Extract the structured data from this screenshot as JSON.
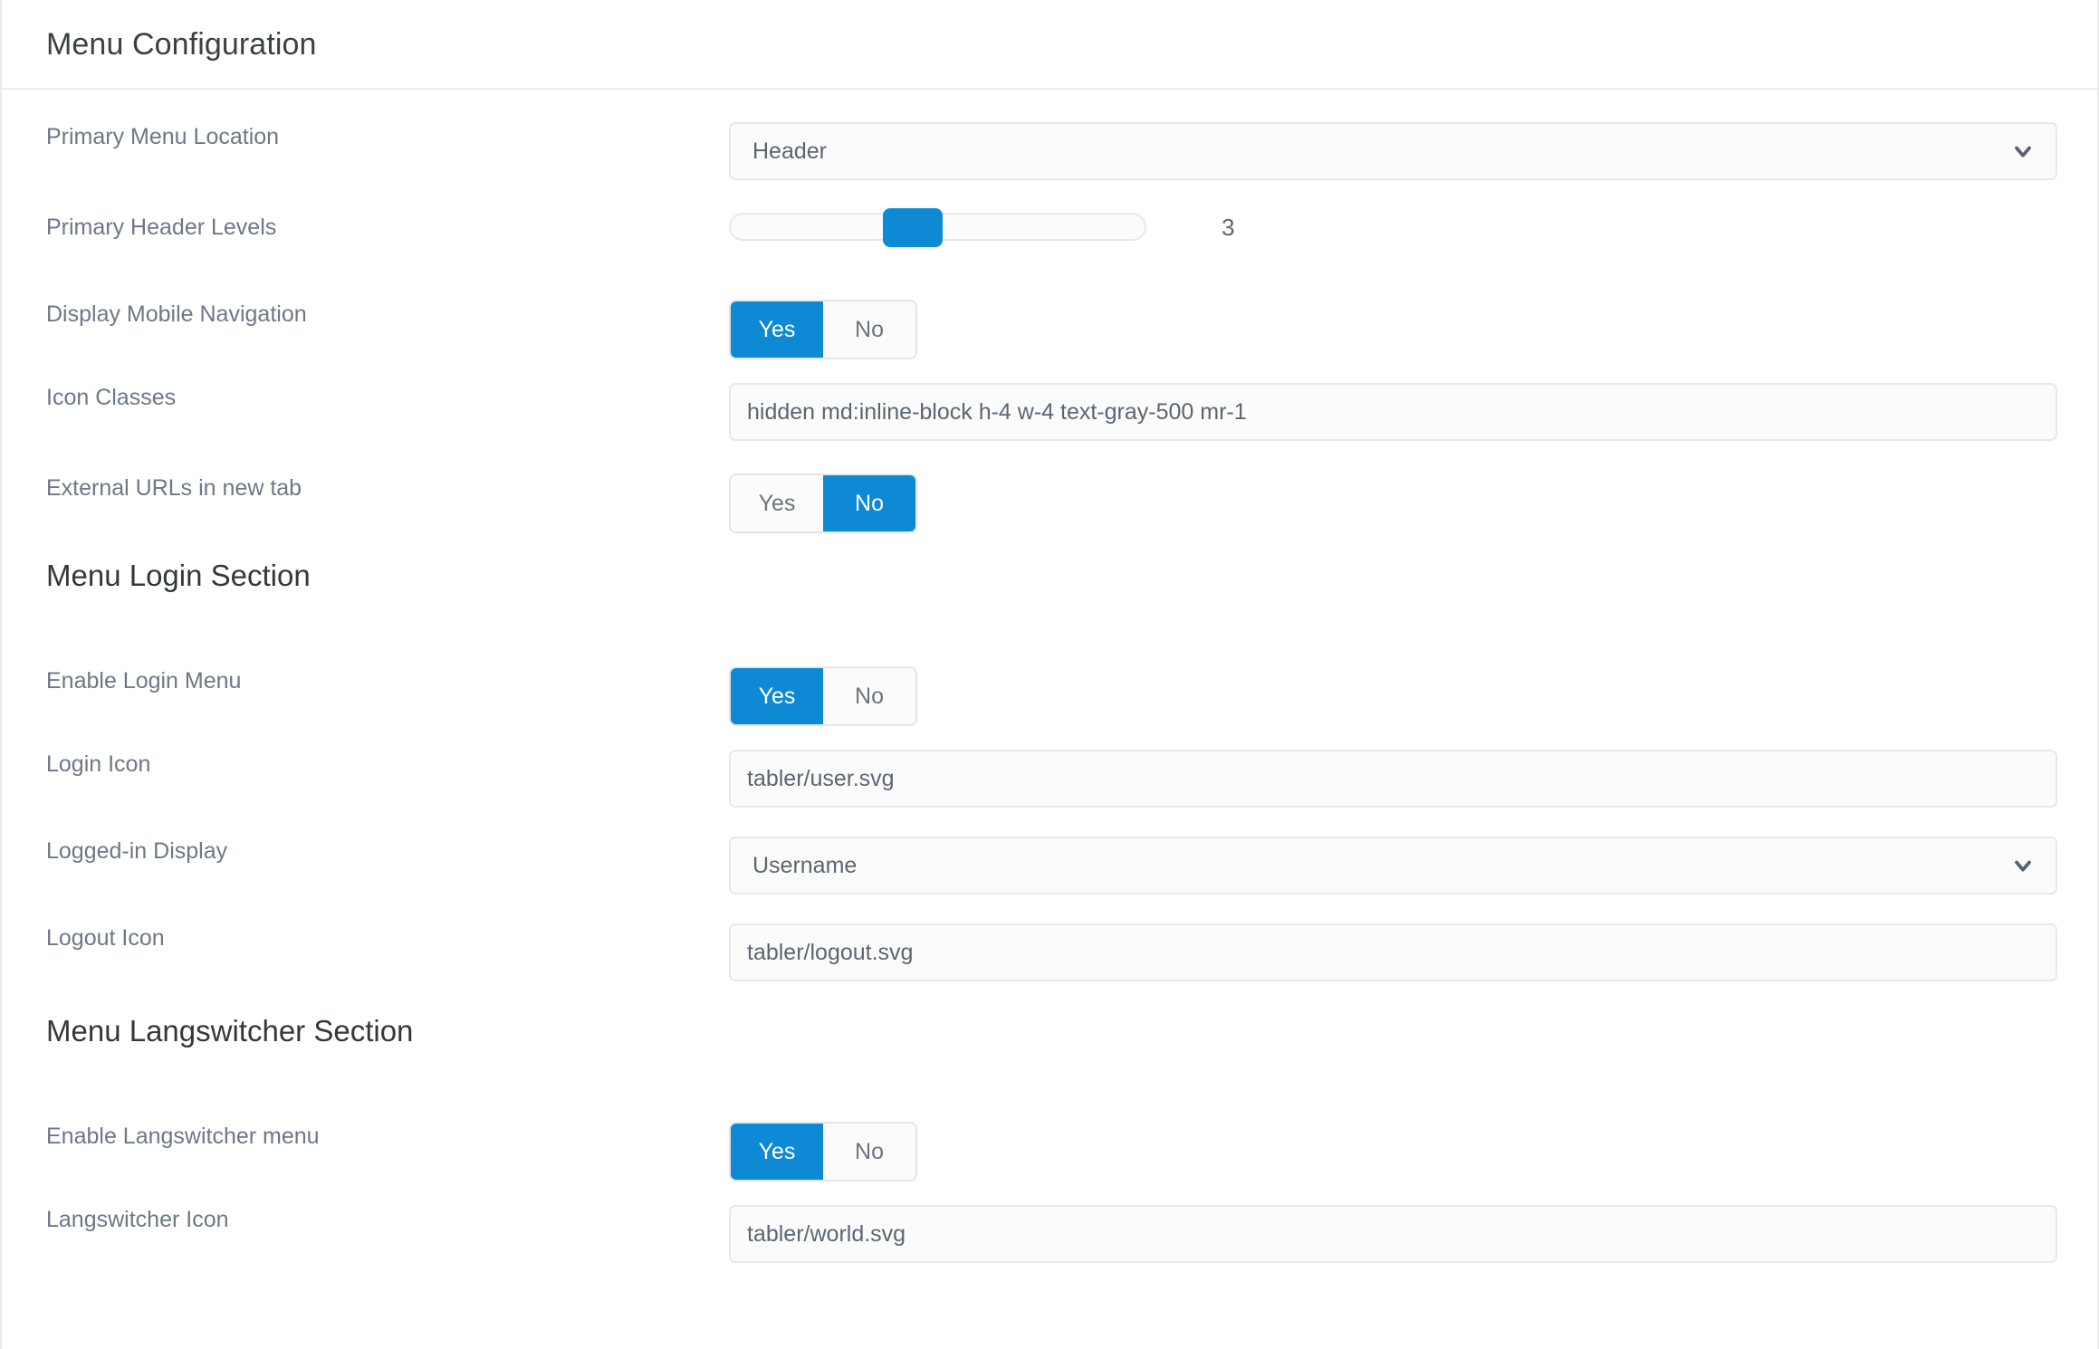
{
  "card": {
    "title": "Menu Configuration"
  },
  "sections": {
    "login_heading": "Menu Login Section",
    "langswitcher_heading": "Menu Langswitcher Section"
  },
  "colors": {
    "accent_blue": "#0e8ad4",
    "label_text": "#6d7886",
    "heading_text": "#33383d",
    "field_border": "#e6e8ea",
    "field_background": "#fbfbfc",
    "value_text": "#5c6670"
  },
  "toggle_options": {
    "yes": "Yes",
    "no": "No"
  },
  "rows": {
    "primary_menu_location": {
      "label": "Primary Menu Location",
      "value": "Header",
      "type": "select"
    },
    "primary_header_levels": {
      "label": "Primary Header Levels",
      "value": "3",
      "type": "slider"
    },
    "display_mobile_navigation": {
      "label": "Display Mobile Navigation",
      "value": "Yes",
      "type": "toggle"
    },
    "icon_classes": {
      "label": "Icon Classes",
      "value": "hidden md:inline-block h-4 w-4 text-gray-500 mr-1",
      "type": "text"
    },
    "external_urls_new_tab": {
      "label": "External URLs in new tab",
      "value": "No",
      "type": "toggle"
    },
    "enable_login_menu": {
      "label": "Enable Login Menu",
      "value": "Yes",
      "type": "toggle"
    },
    "login_icon": {
      "label": "Login Icon",
      "value": "tabler/user.svg",
      "type": "text"
    },
    "logged_in_display": {
      "label": "Logged-in Display",
      "value": "Username",
      "type": "select"
    },
    "logout_icon": {
      "label": "Logout Icon",
      "value": "tabler/logout.svg",
      "type": "text"
    },
    "enable_langswitcher_menu": {
      "label": "Enable Langswitcher menu",
      "value": "Yes",
      "type": "toggle"
    },
    "langswitcher_icon": {
      "label": "Langswitcher Icon",
      "value": "tabler/world.svg",
      "type": "text"
    }
  },
  "icons": {
    "select_chevron": "chevron-down-icon"
  }
}
